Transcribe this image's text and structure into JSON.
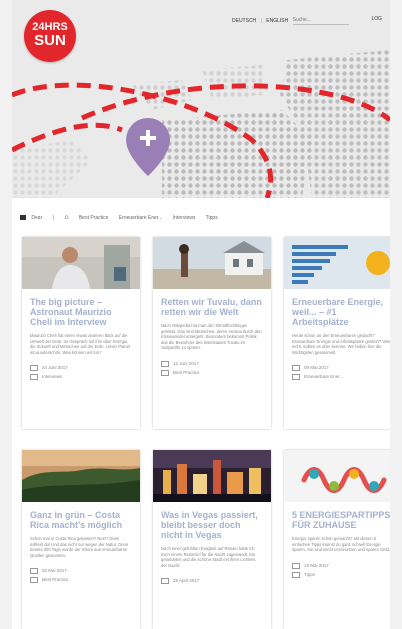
{
  "brand": {
    "line1": "24HRS",
    "line2": "SUN"
  },
  "topnav": {
    "lang_de": "DEUTSCH",
    "lang_en": "ENGLISH",
    "search_placeholder": "Suche...",
    "login": "LOG"
  },
  "breadcrumb": {
    "items": [
      "Dear",
      "Best Practice",
      "Erneuerbare Ener...",
      "Interviews",
      "Tipps"
    ]
  },
  "cards": [
    {
      "title": "The big picture – Astronaut Maurizio Cheli im Interview",
      "text": "Maurizio Cheli hat einen etwas anderen Blick auf die Umwelt der Erde: Im Gespräch mit ihm über Energie, die Zukunft und Menschen auf der Erde. Unser Planet ist wunderschön. Was können wir tun?",
      "date": "24 Juni 2017",
      "category": "Interviews"
    },
    {
      "title": "Retten wir Tuvalu, dann retten wir die Welt",
      "text": "Nach Wikipedia hat man den Klimaflüchtlingen gerettet. Das sind Menschen, deren Heimat durch den Klimawandel untergeht. Besonders bekommt Politik das die Bewohner des Inselstaates Tuvalu im Südpazifik zu spüren.",
      "date": "12 Juni 2017",
      "category": "Best Practice"
    },
    {
      "title": "Erneuerbare Energie, weil... – #1 Arbeitsplätze",
      "text": "Heute schon an den Erneuerbaren gedacht? Erneuerbare Energie und Arbeitsplätze gesetzt? Viele nicht, sollten es aber kennen. Wir haben hier die Wichtigsten gesammelt.",
      "date": "09 Mai 2017",
      "category": "Erneuerbare Ener..."
    },
    {
      "title": "Ganz in grün – Costa Rica macht's möglich",
      "text": "Schon mal in Costa Rica gewesen? Nein? Dann solltest du! Und das nicht nur wegen der Natur. Denn bereits 300 Tage wurde der Strom aus erneuerbaren Quellen gewonnen.",
      "date": "02 Mai 2017",
      "category": "Best Practice"
    },
    {
      "title": "Was in Vegas passiert, bleibt besser doch nicht in Vegas",
      "text": "Nach einer gefühlten Ewigkeit auf Reisen hatte ich mich einem Reiseziel für die Nacht zugewandt. Ein gelandetes und die schöne Stadt mit ihren Lichtern, der Nacht.",
      "date": "26 April 2017",
      "category": "Best Practice"
    },
    {
      "title": "5 ENERGIESPARTIPPS FÜR ZUHAUSE",
      "text": "Energie sparen schon gemacht? Mit diesen 5 einfachen Tipps kannst du ganz schnell Energie sparen. Sie sind leicht umzusetzen und sparen Geld.",
      "date": "19 Mai 2017",
      "category": "Tipps"
    }
  ],
  "colors": {
    "brand_red": "#e3262b",
    "title_blue": "#a5b1d0",
    "map_pin": "#9a7fb6"
  }
}
